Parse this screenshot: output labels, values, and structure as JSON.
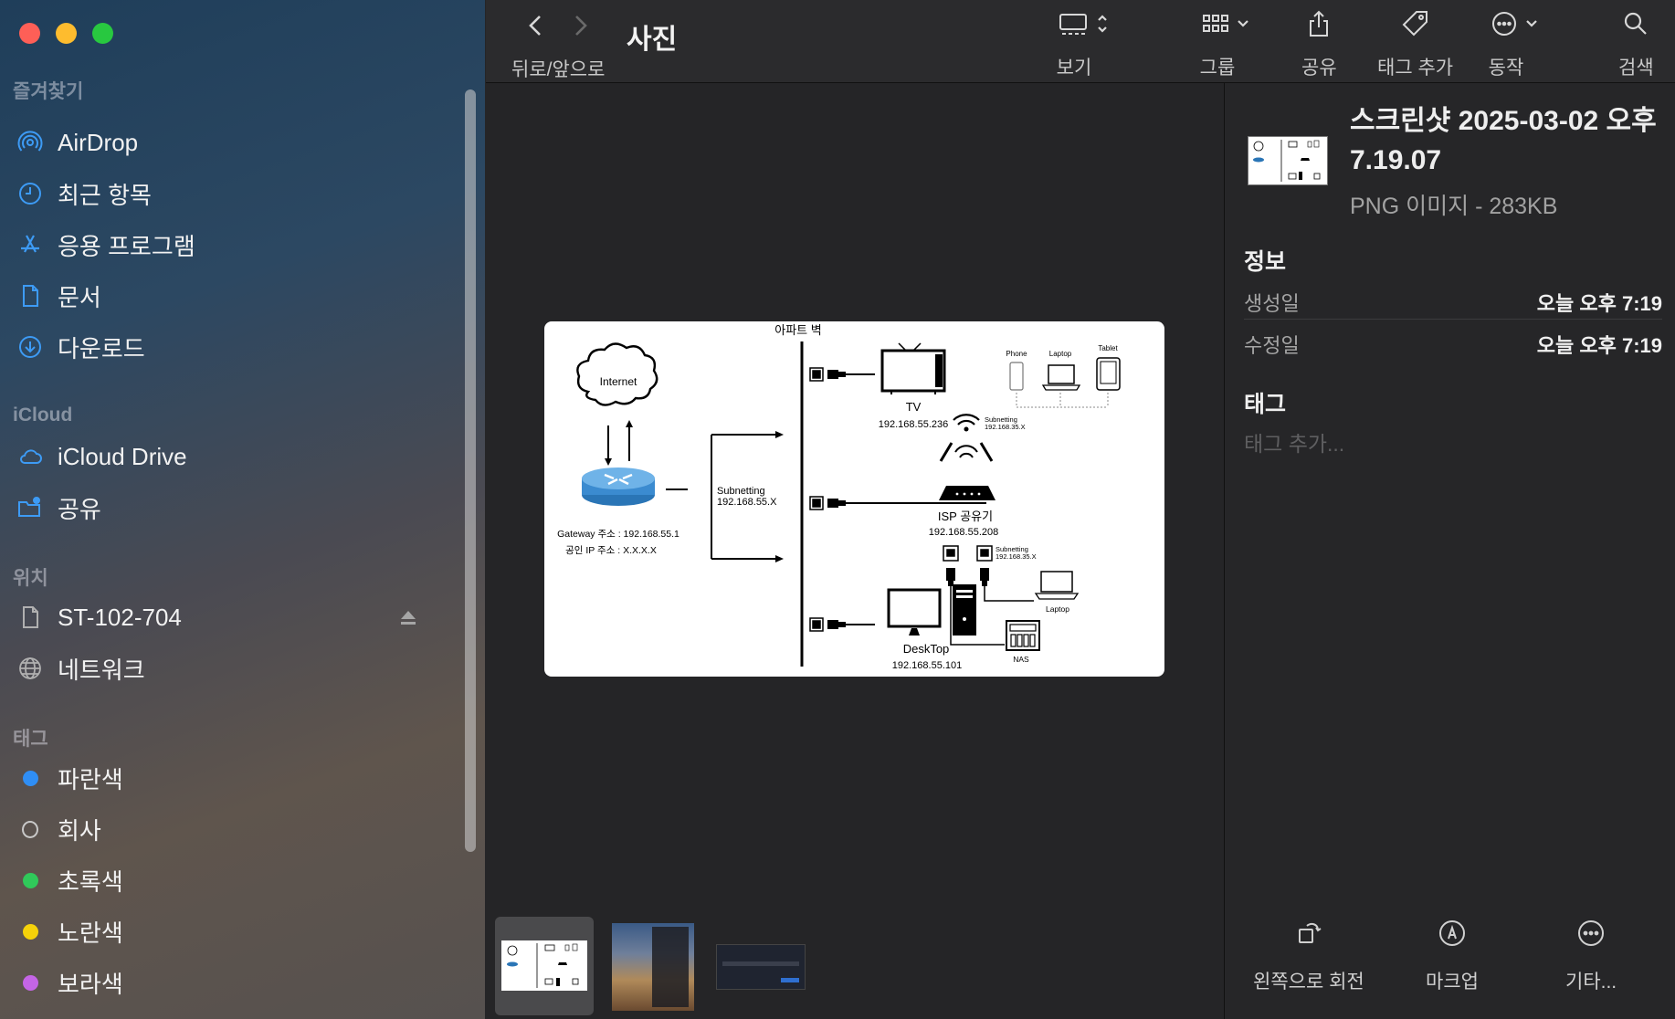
{
  "sidebar": {
    "sections": {
      "favorites": "즐겨찾기",
      "icloud": "iCloud",
      "locations": "위치",
      "tags": "태그"
    },
    "favorites": [
      {
        "label": "AirDrop",
        "icon": "airdrop-icon"
      },
      {
        "label": "최근 항목",
        "icon": "clock-icon"
      },
      {
        "label": "응용 프로그램",
        "icon": "applications-icon"
      },
      {
        "label": "문서",
        "icon": "document-icon"
      },
      {
        "label": "다운로드",
        "icon": "download-icon"
      }
    ],
    "icloud": [
      {
        "label": "iCloud Drive",
        "icon": "cloud-icon"
      },
      {
        "label": "공유",
        "icon": "shared-folder-icon"
      }
    ],
    "locations": [
      {
        "label": "ST-102-704",
        "icon": "file-icon"
      },
      {
        "label": "네트워크",
        "icon": "globe-icon"
      }
    ],
    "tags": [
      {
        "label": "파란색",
        "color": "#2f8ef5"
      },
      {
        "label": "회사",
        "color": "none"
      },
      {
        "label": "초록색",
        "color": "#30c95a"
      },
      {
        "label": "노란색",
        "color": "#f5d20a"
      },
      {
        "label": "보라색",
        "color": "#c465e6"
      }
    ]
  },
  "toolbar": {
    "title": "사진",
    "nav_label": "뒤로/앞으로",
    "view_label": "보기",
    "group_label": "그룹",
    "share_label": "공유",
    "tag_label": "태그 추가",
    "action_label": "동작",
    "search_label": "검색"
  },
  "preview_diagram": {
    "wall": "아파트 벽",
    "internet": "Internet",
    "gateway": "Gateway 주소 : 192.168.55.1",
    "public_ip": "공인 IP 주소 : X.X.X.X",
    "subnet_left_1": "Subnetting",
    "subnet_left_2": "192.168.55.X",
    "tv": "TV",
    "tv_ip": "192.168.55.236",
    "phone": "Phone",
    "laptop_top": "Laptop",
    "tablet": "Tablet",
    "subnet_wifi_1": "Subnetting",
    "subnet_wifi_2": "192.168.35.X",
    "isp": "ISP 공유기",
    "isp_ip": "192.168.55.208",
    "subnet_lan_1": "Subnetting",
    "subnet_lan_2": "192.168.35.X",
    "laptop": "Laptop",
    "nas": "NAS",
    "desktop": "DeskTop",
    "desktop_ip": "192.168.55.101"
  },
  "inspector": {
    "file_name": "스크린샷 2025-03-02 오후 7.19.07",
    "file_type": "PNG 이미지 - 283KB",
    "info_title": "정보",
    "created_label": "생성일",
    "created_value": "오늘 오후 7:19",
    "modified_label": "수정일",
    "modified_value": "오늘 오후 7:19",
    "tags_title": "태그",
    "tags_placeholder": "태그 추가...",
    "actions": {
      "rotate": "왼쪽으로 회전",
      "markup": "마크업",
      "more": "기타..."
    }
  }
}
